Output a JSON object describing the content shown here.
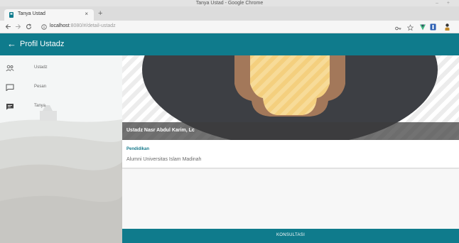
{
  "window": {
    "title": "Tanya Ustad - Google Chrome",
    "controls": "– +"
  },
  "browser": {
    "tab_title": "Tanya Ustad",
    "tab_close": "×",
    "new_tab": "+",
    "address_host": "localhost",
    "address_path": ":8080/#/detail-ustadz"
  },
  "header": {
    "back": "←",
    "title": "Profil Ustadz"
  },
  "sidebar": {
    "items": [
      {
        "label": "Ustadz",
        "icon": "people-icon"
      },
      {
        "label": "Pesan",
        "icon": "chat-outline-icon"
      },
      {
        "label": "Tanya",
        "icon": "chat-filled-icon"
      }
    ]
  },
  "profile": {
    "name": "Ustadz Nasr Abdul Karim, Lc",
    "section_title": "Pendidikan",
    "education": "Alumni Universitas Islam Madinah"
  },
  "actions": {
    "consult": "KONSULTASI"
  },
  "colors": {
    "primary": "#0f7b8c",
    "accent_text": "#177a8c"
  }
}
